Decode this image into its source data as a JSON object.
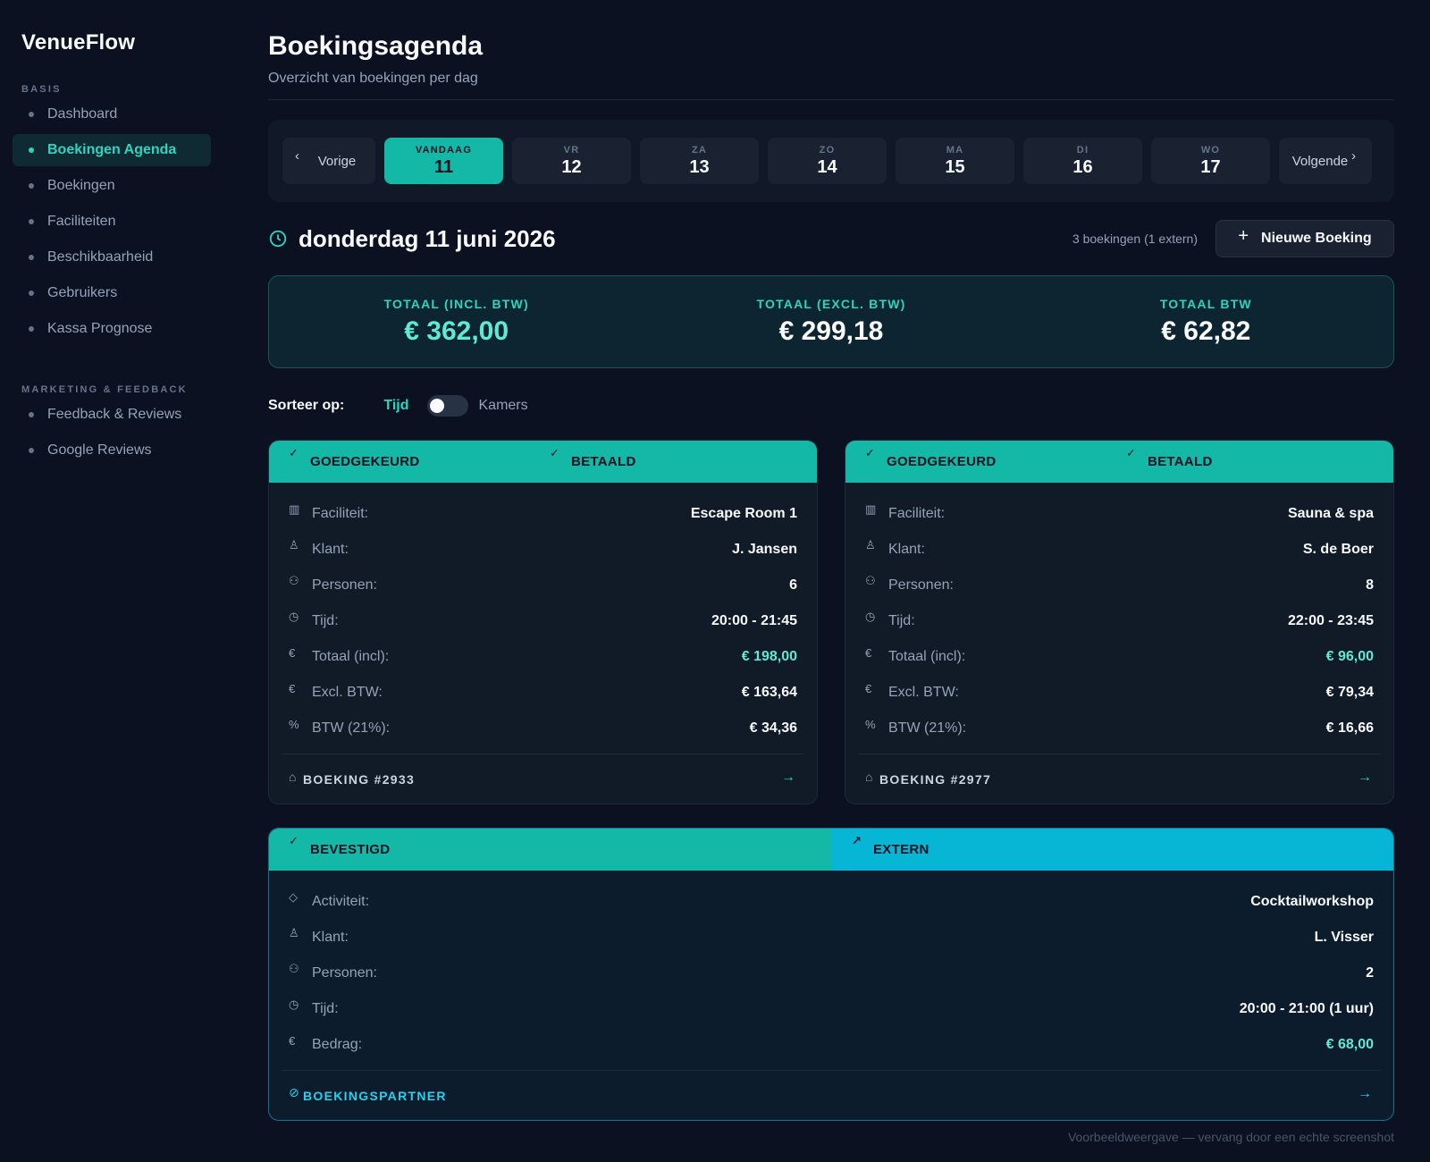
{
  "app": {
    "name": "VenueFlow"
  },
  "sidebar": {
    "sections": [
      {
        "title": "BASIS",
        "items": [
          "Dashboard",
          "Boekingen Agenda",
          "Boekingen",
          "Faciliteiten",
          "Beschikbaarheid",
          "Gebruikers",
          "Kassa Prognose"
        ]
      },
      {
        "title": "MARKETING & FEEDBACK",
        "items": [
          "Feedback & Reviews",
          "Google Reviews"
        ]
      }
    ],
    "active": "Boekingen Agenda"
  },
  "header": {
    "title": "Boekingsagenda",
    "subtitle": "Overzicht van boekingen per dag"
  },
  "day_nav": {
    "prev": "Vorige",
    "next": "Volgende",
    "days": [
      {
        "name": "VANDAAG",
        "num": "11",
        "selected": true
      },
      {
        "name": "VR",
        "num": "12"
      },
      {
        "name": "ZA",
        "num": "13"
      },
      {
        "name": "ZO",
        "num": "14"
      },
      {
        "name": "MA",
        "num": "15"
      },
      {
        "name": "DI",
        "num": "16"
      },
      {
        "name": "WO",
        "num": "17"
      }
    ]
  },
  "day_header": {
    "date": "donderdag 11 juni 2026",
    "count": "3 boekingen (1 extern)",
    "new_button": "Nieuwe Boeking"
  },
  "totals": [
    {
      "label": "TOTAAL (INCL. BTW)",
      "value": "€ 362,00"
    },
    {
      "label": "TOTAAL (EXCL. BTW)",
      "value": "€ 299,18"
    },
    {
      "label": "TOTAAL BTW",
      "value": "€ 62,82"
    }
  ],
  "sort": {
    "label": "Sorteer op:",
    "option_a": "Tijd",
    "option_b": "Kamers",
    "selected": "Tijd"
  },
  "bookings": [
    {
      "badges": [
        "GOEDGEKEURD",
        "BETAALD"
      ],
      "rows": [
        {
          "icon": "building-icon",
          "key": "Faciliteit:",
          "value": "Escape Room 1"
        },
        {
          "icon": "user-icon",
          "key": "Klant:",
          "value": "J. Jansen"
        },
        {
          "icon": "users-icon",
          "key": "Personen:",
          "value": "6"
        },
        {
          "icon": "clock-icon",
          "key": "Tijd:",
          "value": "20:00 - 21:45"
        },
        {
          "icon": "euro-icon",
          "key": "Totaal (incl):",
          "value": "€ 198,00",
          "accent": true
        },
        {
          "icon": "euro-icon",
          "key": "Excl. BTW:",
          "value": "€ 163,64"
        },
        {
          "icon": "percent-icon",
          "key": "BTW (21%):",
          "value": "€ 34,36"
        }
      ],
      "footer": "BOEKING #2933"
    },
    {
      "badges": [
        "GOEDGEKEURD",
        "BETAALD"
      ],
      "rows": [
        {
          "icon": "building-icon",
          "key": "Faciliteit:",
          "value": "Sauna & spa"
        },
        {
          "icon": "user-icon",
          "key": "Klant:",
          "value": "S. de Boer"
        },
        {
          "icon": "users-icon",
          "key": "Personen:",
          "value": "8"
        },
        {
          "icon": "clock-icon",
          "key": "Tijd:",
          "value": "22:00 - 23:45"
        },
        {
          "icon": "euro-icon",
          "key": "Totaal (incl):",
          "value": "€ 96,00",
          "accent": true
        },
        {
          "icon": "euro-icon",
          "key": "Excl. BTW:",
          "value": "€ 79,34"
        },
        {
          "icon": "percent-icon",
          "key": "BTW (21%):",
          "value": "€ 16,66"
        }
      ],
      "footer": "BOEKING #2977"
    },
    {
      "badges": [
        "BEVESTIGD",
        "EXTERN"
      ],
      "rows": [
        {
          "icon": "tag-icon",
          "key": "Activiteit:",
          "value": "Cocktailworkshop"
        },
        {
          "icon": "user-icon",
          "key": "Klant:",
          "value": "L. Visser"
        },
        {
          "icon": "users-icon",
          "key": "Personen:",
          "value": "2"
        },
        {
          "icon": "clock-icon",
          "key": "Tijd:",
          "value": "20:00 - 21:00 (1 uur)"
        },
        {
          "icon": "euro-icon",
          "key": "Bedrag:",
          "value": "€ 68,00",
          "accent": true
        }
      ],
      "footer": "BOEKINGSPARTNER"
    }
  ],
  "colors": {
    "accent": "#14b8a6",
    "accent_light": "#5eead4",
    "extern": "#06b6d4",
    "background": "#0b1120"
  },
  "footnote": "Voorbeeldweergave — vervang door een echte screenshot"
}
